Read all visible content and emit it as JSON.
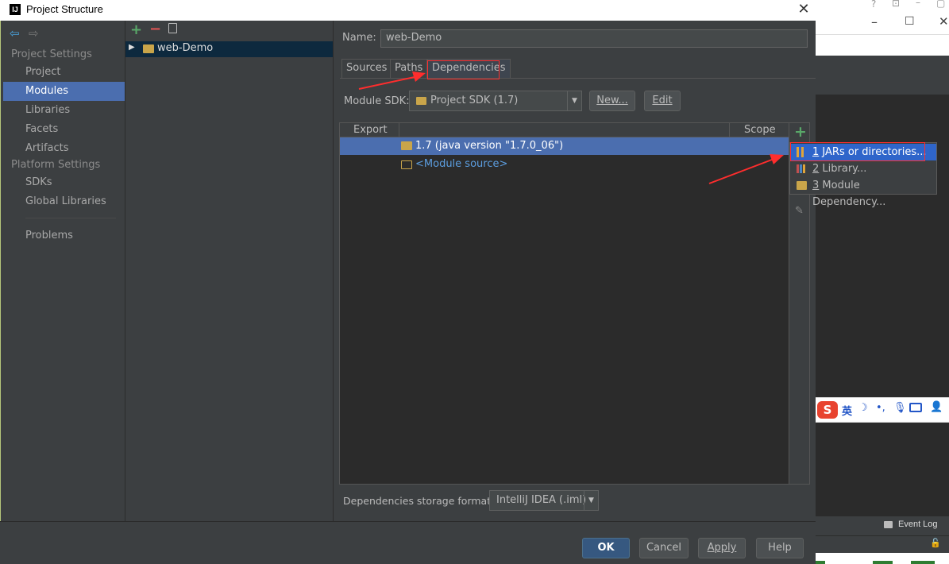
{
  "dialog": {
    "title": "Project Structure",
    "logo": "IJ",
    "close_glyph": "✕"
  },
  "sidebar": {
    "project_settings_header": "Project Settings",
    "platform_settings_header": "Platform Settings",
    "items": [
      {
        "label": "Project"
      },
      {
        "label": "Modules"
      },
      {
        "label": "Libraries"
      },
      {
        "label": "Facets"
      },
      {
        "label": "Artifacts"
      },
      {
        "label": "SDKs"
      },
      {
        "label": "Global Libraries"
      },
      {
        "label": "Problems"
      }
    ]
  },
  "modules_pane": {
    "tree": [
      {
        "label": "web-Demo"
      }
    ]
  },
  "main": {
    "name_label": "Name:",
    "name_value": "web-Demo",
    "tabs": [
      {
        "label": "Sources"
      },
      {
        "label": "Paths"
      },
      {
        "label": "Dependencies"
      }
    ],
    "module_sdk_label": "Module SDK:",
    "module_sdk_value": "Project SDK (1.7)",
    "new_button": "New...",
    "edit_button": "Edit",
    "table_headers": {
      "export": "Export",
      "scope": "Scope"
    },
    "rows": [
      {
        "label": "1.7 (java version \"1.7.0_06\")"
      },
      {
        "label": "<Module source>"
      }
    ],
    "storage_label": "Dependencies storage format:",
    "storage_value": "IntelliJ IDEA (.iml)"
  },
  "popup": {
    "items": [
      {
        "number": "1",
        "label": "JARs or directories..."
      },
      {
        "number": "2",
        "label": "Library..."
      },
      {
        "number": "3",
        "label": "Module Dependency..."
      }
    ]
  },
  "footer": {
    "ok": "OK",
    "cancel": "Cancel",
    "apply": "Apply",
    "help": "Help"
  },
  "background_window": {
    "event_log": "Event Log",
    "ime_text": "英"
  },
  "colors": {
    "selection": "#4b6eaf",
    "popup_selection": "#2f65ca",
    "annotation_red": "#ff2d2d",
    "add_green": "#59a869"
  }
}
